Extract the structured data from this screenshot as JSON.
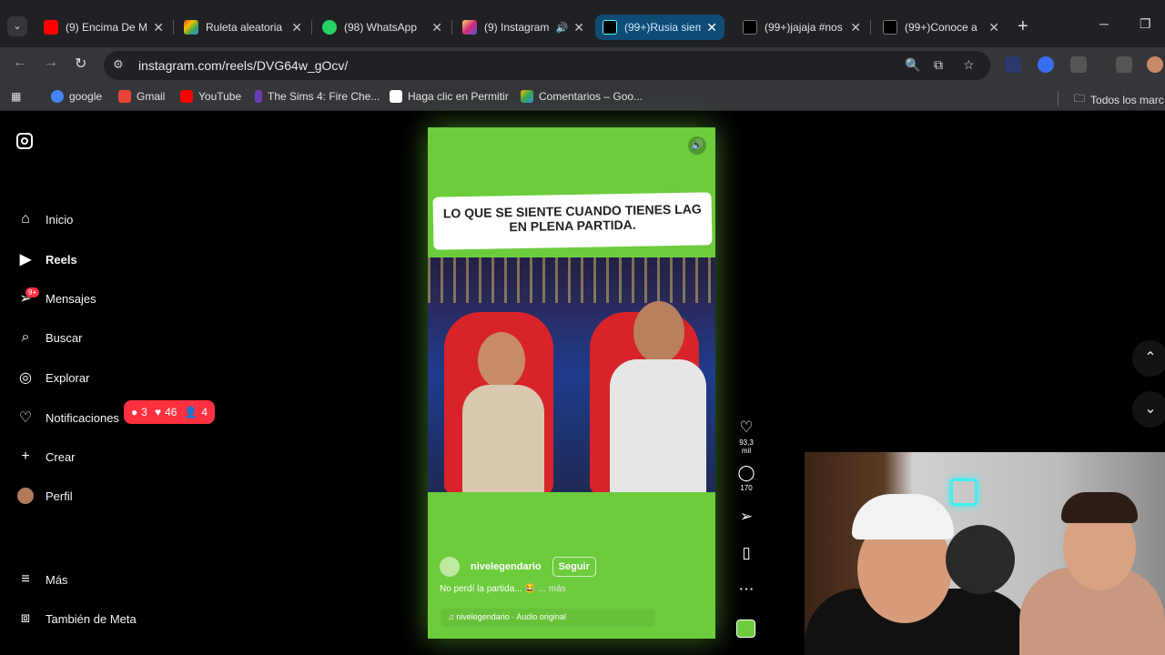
{
  "browser": {
    "tabs": [
      {
        "title": "(9) Encima De M",
        "favicon_color": "#ff0000",
        "active": false
      },
      {
        "title": "Ruleta aleatoria",
        "favicon_color": "#4caf50",
        "active": false
      },
      {
        "title": "(98) WhatsApp",
        "favicon_color": "#25d366",
        "active": false
      },
      {
        "title": "(9) Instagram",
        "favicon_color": "#e1306c",
        "active": false
      },
      {
        "title": "(99+)Rusia siem",
        "favicon_color": "#000000",
        "active": true
      },
      {
        "title": "(99+)jajaja #nos",
        "favicon_color": "#000000",
        "active": false
      },
      {
        "title": "(99+)Conoce a",
        "favicon_color": "#000000",
        "active": false
      }
    ],
    "url": "instagram.com/reels/DVG64w_gOcv/",
    "bookmarks": [
      {
        "label": "google",
        "color": "#4285f4"
      },
      {
        "label": "Gmail",
        "color": "#ea4335"
      },
      {
        "label": "YouTube",
        "color": "#ff0000"
      },
      {
        "label": "The Sims 4: Fire Che...",
        "color": "#6a3fb5"
      },
      {
        "label": "Haga clic en Permitir",
        "color": "#ffffff"
      },
      {
        "label": "Comentarios – Goo...",
        "color": "#fbbc04"
      }
    ],
    "bookmarks_folder": "Todos los marc"
  },
  "sidebar": {
    "items": [
      {
        "label": "Inicio",
        "icon": "home-icon"
      },
      {
        "label": "Reels",
        "icon": "reels-icon"
      },
      {
        "label": "Mensajes",
        "icon": "messages-icon"
      },
      {
        "label": "Buscar",
        "icon": "search-icon"
      },
      {
        "label": "Explorar",
        "icon": "explore-icon"
      },
      {
        "label": "Notificaciones",
        "icon": "heart-icon"
      },
      {
        "label": "Crear",
        "icon": "plus-icon"
      },
      {
        "label": "Perfil",
        "icon": "avatar"
      },
      {
        "label": "Más",
        "icon": "menu-icon"
      },
      {
        "label": "También de Meta",
        "icon": "meta-icon"
      }
    ],
    "messages_badge": "9+",
    "notifications": {
      "comments": "3",
      "likes": "46",
      "follows": "4"
    }
  },
  "reel": {
    "caption_overlay": "LO QUE SE SIENTE CUANDO TIENES LAG EN PLENA PARTIDA.",
    "username": "nivelegendario",
    "follow_label": "Seguir",
    "description": "No perdí la partida... 😂",
    "more_label": "... más",
    "audio": "nivelegendario · Audio original",
    "likes": "93,3 mil",
    "comments": "170",
    "accent_color": "#6ccc3c"
  }
}
